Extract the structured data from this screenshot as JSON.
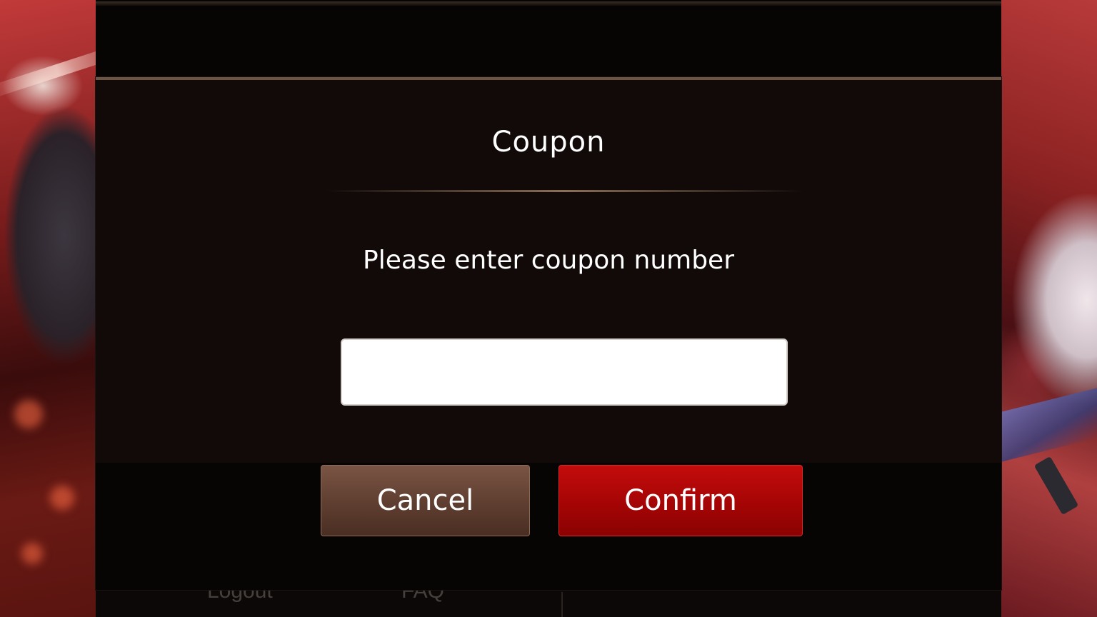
{
  "dialog": {
    "title": "Coupon",
    "message": "Please enter coupon number",
    "input": {
      "value": "",
      "placeholder": ""
    },
    "cancel_label": "Cancel",
    "confirm_label": "Confirm"
  },
  "background_menu": {
    "items": [
      "Logout",
      "FAQ"
    ]
  },
  "colors": {
    "modal_background": "#110a09",
    "cancel_button": "#5e3e30",
    "confirm_button": "#a20404",
    "border_accent": "#6a5446"
  }
}
